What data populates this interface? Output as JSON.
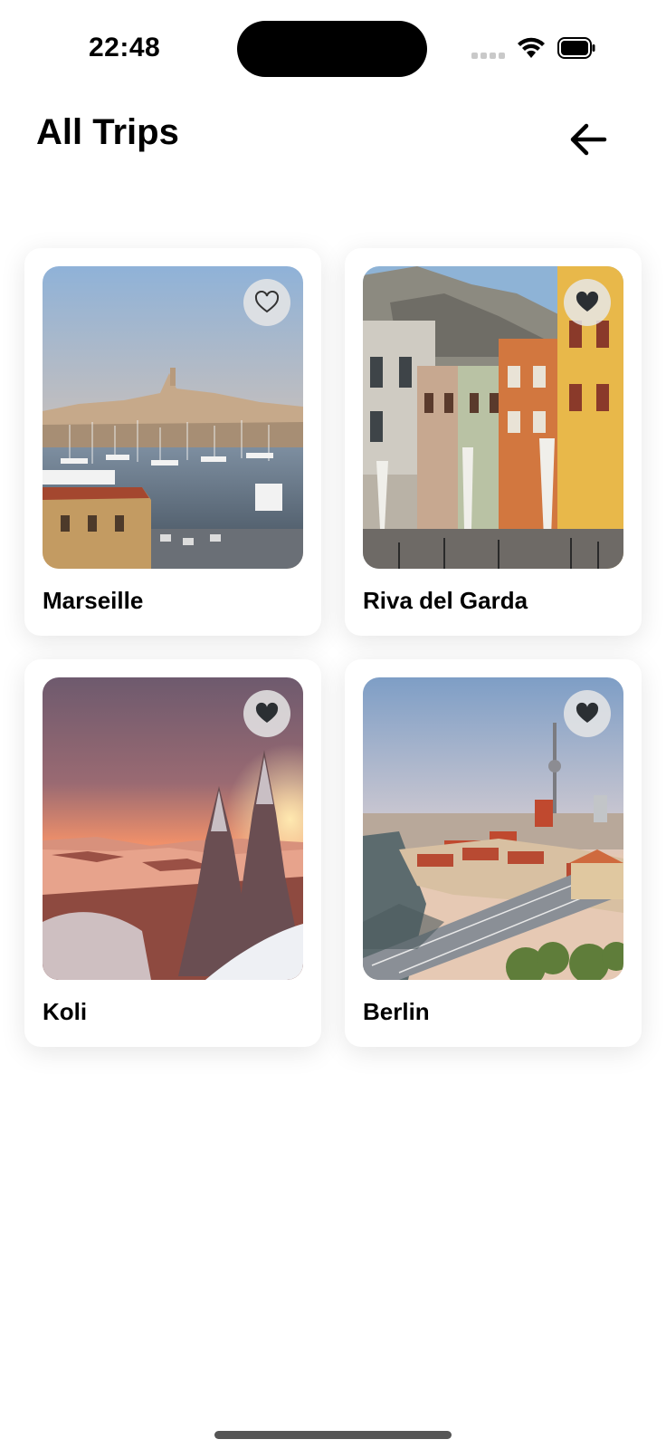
{
  "status_bar": {
    "time": "22:48",
    "icons": [
      "signal-icon",
      "wifi-icon",
      "battery-icon"
    ]
  },
  "header": {
    "title": "All Trips",
    "back_icon": "arrow-left-icon"
  },
  "trips": [
    {
      "name": "Marseille",
      "favorite": false,
      "heart_icon": "heart-outline-icon"
    },
    {
      "name": "Riva del Garda",
      "favorite": true,
      "heart_icon": "heart-filled-icon"
    },
    {
      "name": "Koli",
      "favorite": true,
      "heart_icon": "heart-filled-icon"
    },
    {
      "name": "Berlin",
      "favorite": true,
      "heart_icon": "heart-filled-icon"
    }
  ],
  "colors": {
    "background": "#ffffff",
    "card": "#ffffff",
    "text": "#000000",
    "heart_filled": "#2b2f33"
  }
}
